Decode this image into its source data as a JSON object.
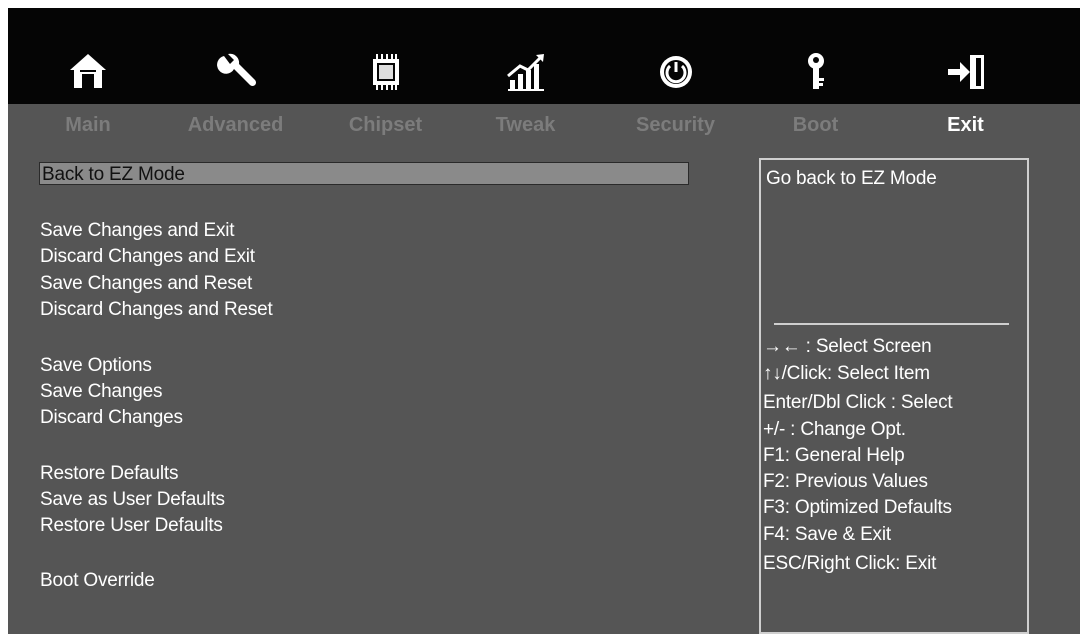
{
  "tabs": [
    {
      "label": "Main",
      "icon": "home-icon"
    },
    {
      "label": "Advanced",
      "icon": "wrench-icon"
    },
    {
      "label": "Chipset",
      "icon": "chip-icon"
    },
    {
      "label": "Tweak",
      "icon": "chart-icon"
    },
    {
      "label": "Security",
      "icon": "power-icon"
    },
    {
      "label": "Boot",
      "icon": "key-icon"
    },
    {
      "label": "Exit",
      "icon": "exit-icon"
    }
  ],
  "active_tab": "Exit",
  "menu": {
    "selected": "Back to EZ Mode",
    "items": [
      "Save Changes and Exit",
      "Discard Changes and Exit",
      "Save Changes and Reset",
      "Discard Changes and Reset",
      "Save Options",
      "Save Changes",
      "Discard Changes",
      "Restore Defaults",
      "Save as User Defaults",
      "Restore User Defaults",
      "Boot Override"
    ]
  },
  "help": {
    "description": "Go back to EZ Mode",
    "keys": [
      "→←  : Select Screen",
      "↑↓/Click: Select Item",
      "Enter/Dbl Click : Select",
      "+/- : Change Opt.",
      "F1: General Help",
      "F2: Previous Values",
      "F3: Optimized Defaults",
      "F4: Save & Exit",
      "ESC/Right Click: Exit"
    ]
  },
  "colors": {
    "background": "#555555",
    "topbar": "#050505",
    "inactive_tab": "#7c7c7c",
    "selected_row": "#8a8a8a"
  }
}
